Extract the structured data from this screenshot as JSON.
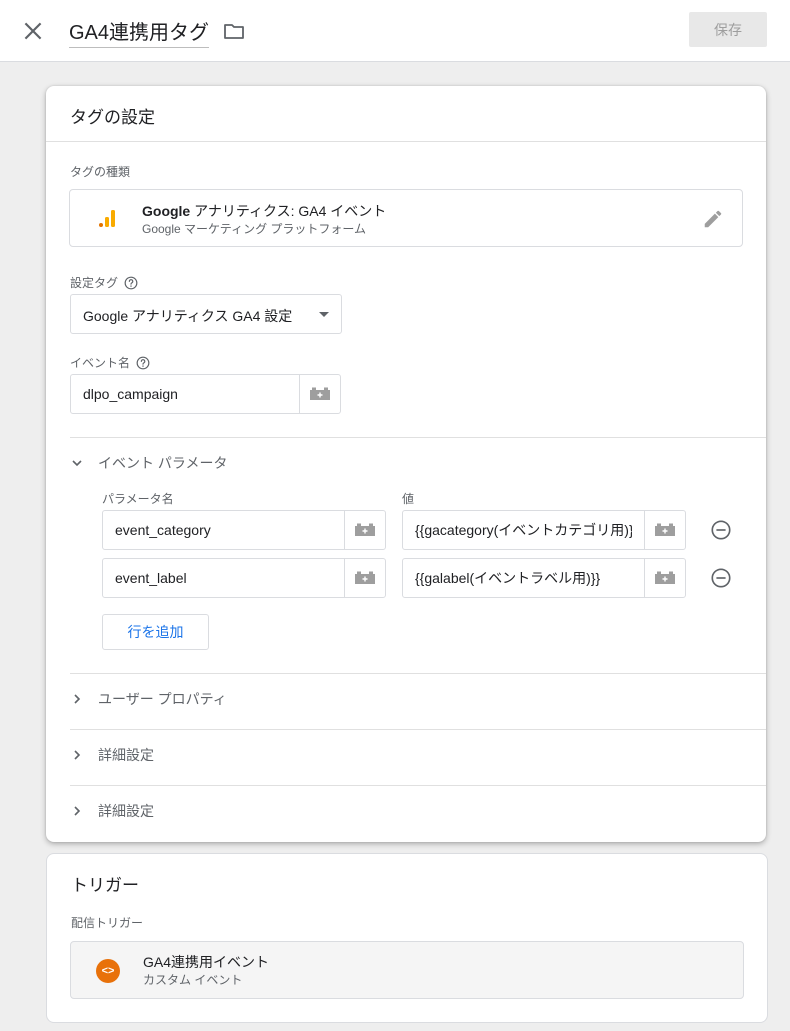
{
  "header": {
    "title": "GA4連携用タグ",
    "save_label": "保存"
  },
  "tag_config": {
    "title": "タグの設定",
    "tag_type_label": "タグの種類",
    "tag_type": {
      "name_bold": "Google",
      "name_rest": " アナリティクス: GA4 イベント",
      "subtitle": "Google マーケティング プラットフォーム",
      "icon": "analytics-bars-icon",
      "icon_color": "#f9ab00"
    },
    "config_tag_label": "設定タグ",
    "config_tag_value": "Google アナリティクス GA4 設定",
    "event_name_label": "イベント名",
    "event_name_value": "dlpo_campaign",
    "event_params": {
      "title": "イベント パラメータ",
      "col_name": "パラメータ名",
      "col_value": "値",
      "rows": [
        {
          "name": "event_category",
          "value": "{{gacategory(イベントカテゴリ用)}}"
        },
        {
          "name": "event_label",
          "value": "{{galabel(イベントラベル用)}}"
        }
      ],
      "add_row_label": "行を追加"
    },
    "user_properties_label": "ユーザー プロパティ",
    "advanced_label_1": "詳細設定",
    "advanced_label_2": "詳細設定"
  },
  "trigger": {
    "title": "トリガー",
    "firing_label": "配信トリガー",
    "item": {
      "name": "GA4連携用イベント",
      "type": "カスタム イベント",
      "icon_glyph": "<>",
      "icon_color": "#e8710a"
    }
  }
}
